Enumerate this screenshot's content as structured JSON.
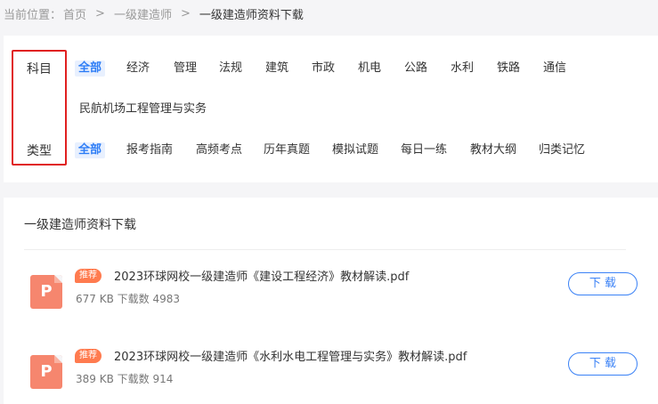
{
  "breadcrumb": {
    "prefix": "当前位置：",
    "home": "首页",
    "sep1": ">",
    "level2": "一级建造师",
    "sep2": ">",
    "current": "一级建造师资料下载"
  },
  "filter": {
    "subject_label": "科目",
    "type_label": "类型",
    "subjects": [
      "全部",
      "经济",
      "管理",
      "法规",
      "建筑",
      "市政",
      "机电",
      "公路",
      "水利",
      "铁路",
      "通信",
      "民航机场工程管理与实务"
    ],
    "types": [
      "全部",
      "报考指南",
      "高频考点",
      "历年真题",
      "模拟试题",
      "每日一练",
      "教材大纲",
      "归类记忆"
    ],
    "highlight_color": "#e02020",
    "active_color": "#2d7df6"
  },
  "list": {
    "title": "一级建造师资料下载",
    "items": [
      {
        "badge": "推荐",
        "icon_letter": "P",
        "name": "2023环球网校一级建造师《建设工程经济》教材解读.pdf",
        "meta": "677 KB 下载数 4983",
        "download_label": "下 载"
      },
      {
        "badge": "推荐",
        "icon_letter": "P",
        "name": "2023环球网校一级建造师《水利水电工程管理与实务》教材解读.pdf",
        "meta": "389 KB 下载数 914",
        "download_label": "下 载"
      }
    ],
    "badge_color": "#ff7b4f",
    "button_color": "#3b82f6"
  }
}
